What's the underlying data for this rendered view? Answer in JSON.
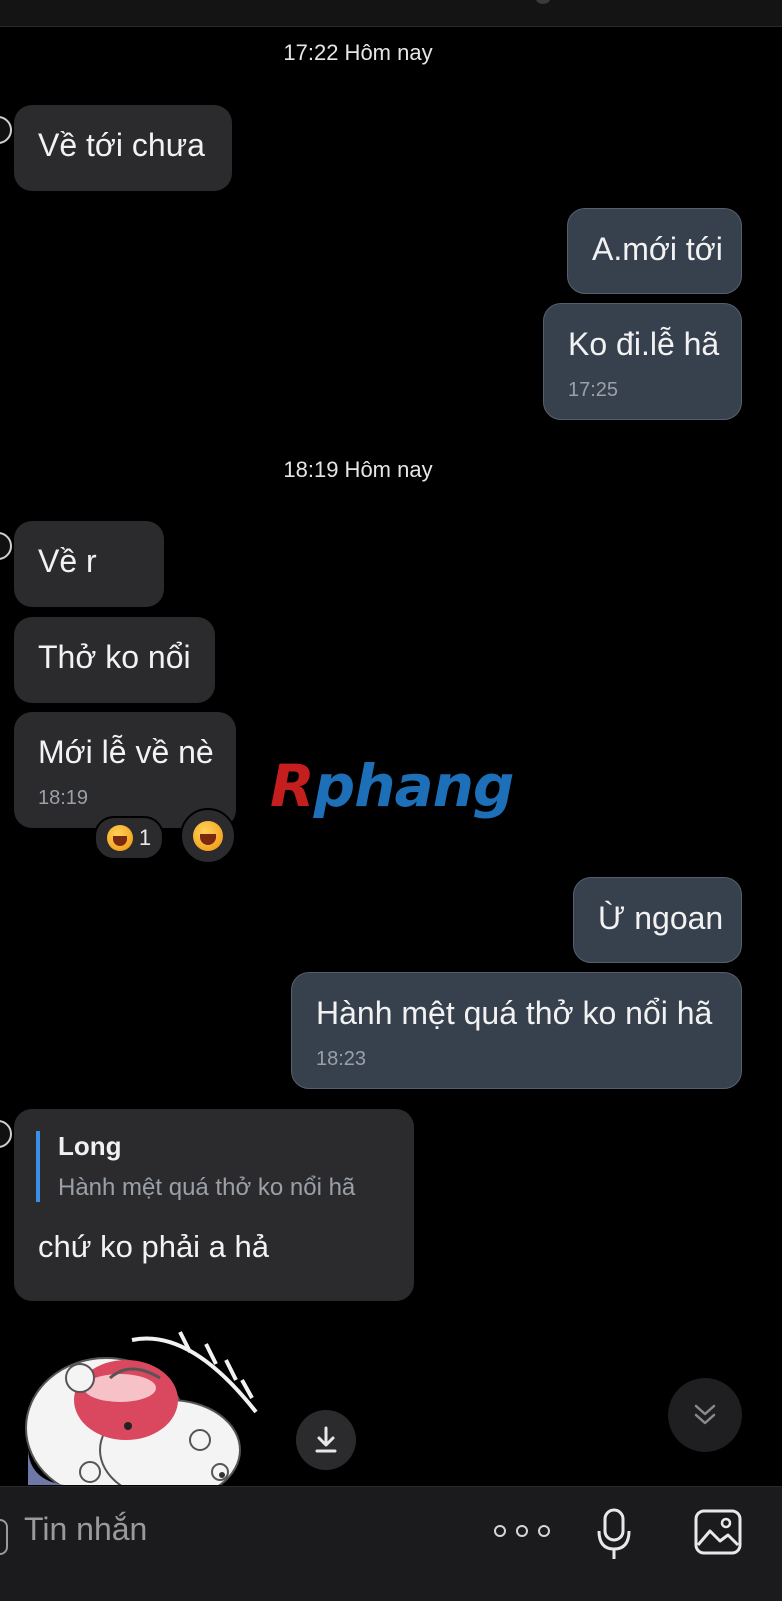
{
  "header": {
    "title": ""
  },
  "messages": {
    "timestamp_1": "17:22 Hôm nay",
    "in_1": "Về tới chưa",
    "out_1": "A.mới tới",
    "out_2": "Ko đi.lễ hã",
    "out_2_time": "17:25",
    "timestamp_2": "18:19 Hôm nay",
    "in_2": "Về r",
    "in_3": "Thở ko nổi",
    "in_4": "Mới lễ về nè",
    "in_4_time": "18:19",
    "reaction_count": "1",
    "reaction_emoji": "laughing-crying-emoji",
    "out_3": "Ừ ngoan",
    "out_4": "Hành mệt quá thở ko nổi hã",
    "out_4_time": "18:23",
    "reply": {
      "quoted_name": "Long",
      "quoted_text": "Hành mệt quá thở ko nổi hã",
      "body": "chứ ko phải a hả"
    }
  },
  "watermark": {
    "first": "R",
    "rest": "phang"
  },
  "input_bar": {
    "placeholder": "Tin nhắn",
    "icons": [
      "more-icon",
      "mic-icon",
      "image-icon"
    ]
  },
  "colors": {
    "background": "#000000",
    "incoming_bubble": "#2b2b2d",
    "outgoing_bubble": "#37414d",
    "reply_accent": "#3b8fe6",
    "watermark_red": "#c41e1e",
    "watermark_blue": "#1d6fb8"
  }
}
